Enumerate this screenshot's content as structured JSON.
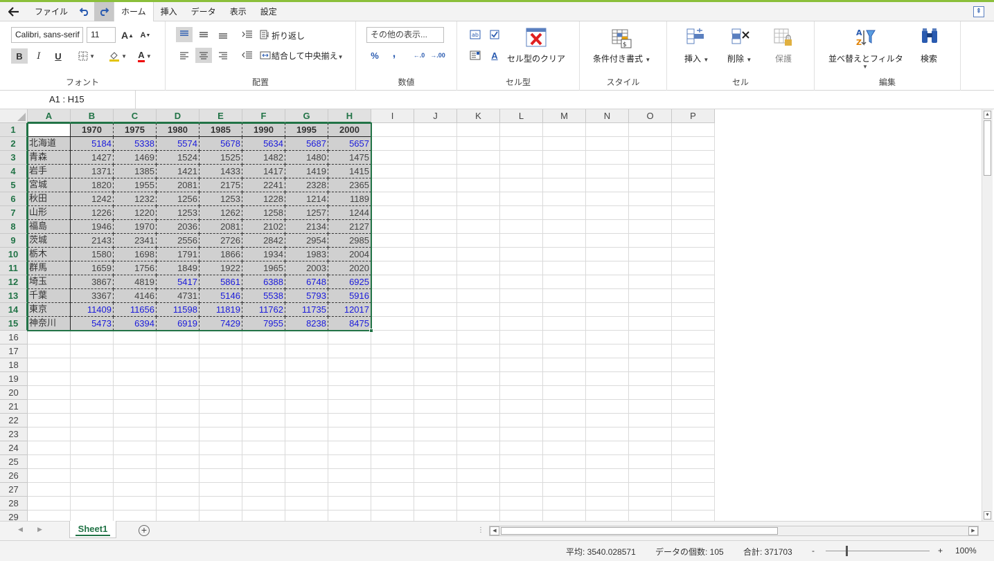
{
  "menu": {
    "back_icon": "back-arrow-icon",
    "file": "ファイル",
    "undo_icon": "undo-icon",
    "redo_icon": "redo-icon",
    "tabs": [
      "ホーム",
      "挿入",
      "データ",
      "表示",
      "設定"
    ],
    "active_tab": "ホーム"
  },
  "ribbon": {
    "font": {
      "family": "Calibri, sans-serif",
      "size": "11",
      "label": "フォント",
      "grow": "A",
      "shrink": "A",
      "bold": "B",
      "italic": "I",
      "underline": "U",
      "font_color_letter": "A"
    },
    "alignment": {
      "wrap": "折り返し",
      "merge": "結合して中央揃え",
      "label": "配置"
    },
    "number": {
      "format": "その他の表示...",
      "percent": "%",
      "comma": ",",
      "inc_decimal": ".0",
      "dec_decimal": ".00",
      "label": "数値"
    },
    "cell_type": {
      "clear": "セル型のクリア",
      "label": "セル型"
    },
    "style": {
      "conditional": "条件付き書式",
      "label": "スタイル"
    },
    "cells": {
      "insert": "挿入",
      "delete": "削除",
      "protect": "保護",
      "label": "セル"
    },
    "edit": {
      "sort_filter": "並べ替えとフィルタ",
      "find": "検索",
      "label": "編集"
    }
  },
  "namebox": "A1 : H15",
  "columns": [
    "A",
    "B",
    "C",
    "D",
    "E",
    "F",
    "G",
    "H",
    "I",
    "J",
    "K",
    "L",
    "M",
    "N",
    "O",
    "P"
  ],
  "row_numbers": [
    "1",
    "2",
    "3",
    "4",
    "5",
    "6",
    "7",
    "8",
    "9",
    "10",
    "11",
    "12",
    "13",
    "14",
    "15",
    "16",
    "17",
    "18",
    "19",
    "20",
    "21",
    "22",
    "23",
    "24",
    "25",
    "26",
    "27",
    "28",
    "29"
  ],
  "table": {
    "years": [
      "1970",
      "1975",
      "1980",
      "1985",
      "1990",
      "1995",
      "2000"
    ],
    "rows": [
      {
        "pref": "北海道",
        "values": [
          "5184",
          "5338",
          "5574",
          "5678",
          "5634",
          "5687",
          "5657"
        ],
        "blue": [
          1,
          1,
          1,
          1,
          1,
          1,
          1
        ]
      },
      {
        "pref": "青森",
        "values": [
          "1427",
          "1469",
          "1524",
          "1525",
          "1482",
          "1480",
          "1475"
        ],
        "blue": [
          0,
          0,
          0,
          0,
          0,
          0,
          0
        ]
      },
      {
        "pref": "岩手",
        "values": [
          "1371",
          "1385",
          "1421",
          "1433",
          "1417",
          "1419",
          "1415"
        ],
        "blue": [
          0,
          0,
          0,
          0,
          0,
          0,
          0
        ]
      },
      {
        "pref": "宮城",
        "values": [
          "1820",
          "1955",
          "2081",
          "2175",
          "2241",
          "2328",
          "2365"
        ],
        "blue": [
          0,
          0,
          0,
          0,
          0,
          0,
          0
        ]
      },
      {
        "pref": "秋田",
        "values": [
          "1242",
          "1232",
          "1256",
          "1253",
          "1228",
          "1214",
          "1189"
        ],
        "blue": [
          0,
          0,
          0,
          0,
          0,
          0,
          0
        ]
      },
      {
        "pref": "山形",
        "values": [
          "1226",
          "1220",
          "1253",
          "1262",
          "1258",
          "1257",
          "1244"
        ],
        "blue": [
          0,
          0,
          0,
          0,
          0,
          0,
          0
        ]
      },
      {
        "pref": "福島",
        "values": [
          "1946",
          "1970",
          "2036",
          "2081",
          "2102",
          "2134",
          "2127"
        ],
        "blue": [
          0,
          0,
          0,
          0,
          0,
          0,
          0
        ]
      },
      {
        "pref": "茨城",
        "values": [
          "2143",
          "2341",
          "2556",
          "2726",
          "2842",
          "2954",
          "2985"
        ],
        "blue": [
          0,
          0,
          0,
          0,
          0,
          0,
          0
        ]
      },
      {
        "pref": "栃木",
        "values": [
          "1580",
          "1698",
          "1791",
          "1866",
          "1934",
          "1983",
          "2004"
        ],
        "blue": [
          0,
          0,
          0,
          0,
          0,
          0,
          0
        ]
      },
      {
        "pref": "群馬",
        "values": [
          "1659",
          "1756",
          "1849",
          "1922",
          "1965",
          "2003",
          "2020"
        ],
        "blue": [
          0,
          0,
          0,
          0,
          0,
          0,
          0
        ]
      },
      {
        "pref": "埼玉",
        "values": [
          "3867",
          "4819",
          "5417",
          "5861",
          "6388",
          "6748",
          "6925"
        ],
        "blue": [
          0,
          0,
          1,
          1,
          1,
          1,
          1
        ]
      },
      {
        "pref": "千葉",
        "values": [
          "3367",
          "4146",
          "4731",
          "5146",
          "5538",
          "5793",
          "5916"
        ],
        "blue": [
          0,
          0,
          0,
          1,
          1,
          1,
          1
        ]
      },
      {
        "pref": "東京",
        "values": [
          "11409",
          "11656",
          "11598",
          "11819",
          "11762",
          "11735",
          "12017"
        ],
        "blue": [
          1,
          1,
          1,
          1,
          1,
          1,
          1
        ]
      },
      {
        "pref": "神奈川",
        "values": [
          "5473",
          "6394",
          "6919",
          "7429",
          "7955",
          "8238",
          "8475"
        ],
        "blue": [
          1,
          1,
          1,
          1,
          1,
          1,
          1
        ]
      }
    ]
  },
  "sheet_tab": "Sheet1",
  "status": {
    "average": "平均: 3540.028571",
    "count": "データの個数: 105",
    "sum": "合計: 371703",
    "zoom_minus": "-",
    "zoom_plus": "+",
    "zoom": "100%"
  },
  "colors": {
    "accent": "#217346",
    "blue_value": "#1a1adb",
    "selection_fill": "#d0d0d0"
  }
}
